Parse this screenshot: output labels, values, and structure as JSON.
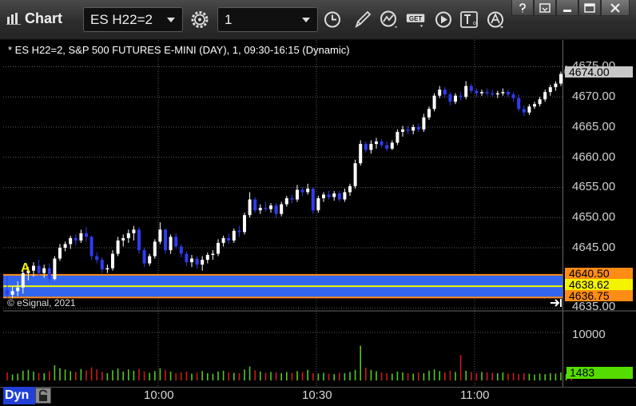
{
  "window": {
    "title": "Chart"
  },
  "toolbar": {
    "symbol": "ES H22=2",
    "interval": "1",
    "buttons": [
      "gear-icon",
      "clock-icon",
      "pencil-icon",
      "study-icon",
      "get-icon",
      "play-icon",
      "text-icon",
      "alert-icon"
    ],
    "get_label": "GET"
  },
  "chart": {
    "header": "* ES H22=2, S&P 500 FUTURES E-MINI (DAY), 1, 09:30-16:15 (Dynamic)",
    "copyright": "© eSignal, 2021",
    "marker_label": "A",
    "dyn_label": "Dyn",
    "colors": {
      "up": "#ffffff",
      "down": "#2f3cf0",
      "grid": "#5a5a5a",
      "band": "#3366ee",
      "vol_up": "#55c81c",
      "vol_down": "#cc1a1a"
    }
  },
  "price_axis": {
    "labels": [
      "4675.00",
      "4670.00",
      "4665.00",
      "4660.00",
      "4655.00",
      "4650.00",
      "4645.00",
      "4635.00"
    ],
    "last_price": "4674.00",
    "upper_level": "4640.50",
    "mid_level": "4638.62",
    "lower_level": "4636.75"
  },
  "volume_axis": {
    "tick": "10000",
    "last_volume": "1483"
  },
  "time_axis": {
    "labels": [
      "10:00",
      "10:30",
      "11:00"
    ]
  },
  "chart_data": {
    "type": "candlestick",
    "ylim": [
      4634.5,
      4676.5
    ],
    "start_time": "09:30",
    "bar_minutes": 1,
    "bars": [
      [
        4638.0,
        4640.2,
        4636.6,
        4637.2
      ],
      [
        4637.2,
        4638.6,
        4636.6,
        4637.8
      ],
      [
        4637.8,
        4639.4,
        4637.0,
        4638.4
      ],
      [
        4638.4,
        4641.2,
        4637.4,
        4640.8
      ],
      [
        4640.8,
        4641.8,
        4639.6,
        4641.2
      ],
      [
        4641.2,
        4642.6,
        4640.2,
        4642.0
      ],
      [
        4642.0,
        4643.0,
        4640.4,
        4640.8
      ],
      [
        4640.8,
        4642.2,
        4640.0,
        4641.6
      ],
      [
        4641.6,
        4642.4,
        4639.2,
        4639.8
      ],
      [
        4639.8,
        4643.6,
        4639.6,
        4643.2
      ],
      [
        4643.2,
        4645.6,
        4642.8,
        4645.0
      ],
      [
        4645.0,
        4646.0,
        4644.4,
        4645.6
      ],
      [
        4645.6,
        4647.0,
        4644.8,
        4646.6
      ],
      [
        4646.6,
        4647.2,
        4645.4,
        4646.2
      ],
      [
        4646.2,
        4648.0,
        4645.8,
        4647.4
      ],
      [
        4647.4,
        4648.4,
        4646.0,
        4646.8
      ],
      [
        4646.8,
        4647.0,
        4643.0,
        4643.6
      ],
      [
        4643.6,
        4644.2,
        4642.4,
        4643.0
      ],
      [
        4643.0,
        4643.4,
        4640.8,
        4641.4
      ],
      [
        4641.4,
        4642.2,
        4640.8,
        4641.6
      ],
      [
        4641.6,
        4644.6,
        4641.2,
        4644.0
      ],
      [
        4644.0,
        4646.8,
        4643.6,
        4646.2
      ],
      [
        4646.2,
        4647.2,
        4645.2,
        4646.6
      ],
      [
        4646.6,
        4648.0,
        4645.8,
        4647.4
      ],
      [
        4647.4,
        4648.6,
        4646.2,
        4648.0
      ],
      [
        4648.0,
        4648.4,
        4644.0,
        4644.6
      ],
      [
        4644.6,
        4645.0,
        4641.8,
        4642.4
      ],
      [
        4642.4,
        4644.0,
        4642.0,
        4643.6
      ],
      [
        4643.6,
        4646.4,
        4643.2,
        4646.0
      ],
      [
        4646.0,
        4649.2,
        4645.6,
        4648.0
      ],
      [
        4648.0,
        4648.2,
        4644.0,
        4644.6
      ],
      [
        4644.6,
        4647.2,
        4644.0,
        4646.8
      ],
      [
        4646.8,
        4647.4,
        4644.8,
        4645.2
      ],
      [
        4645.2,
        4645.6,
        4643.4,
        4644.0
      ],
      [
        4644.0,
        4644.4,
        4642.0,
        4642.6
      ],
      [
        4642.6,
        4643.8,
        4641.8,
        4643.2
      ],
      [
        4643.2,
        4643.6,
        4641.6,
        4642.2
      ],
      [
        4642.2,
        4643.6,
        4641.2,
        4643.0
      ],
      [
        4643.0,
        4644.2,
        4642.4,
        4643.8
      ],
      [
        4643.8,
        4644.6,
        4643.0,
        4644.0
      ],
      [
        4644.0,
        4646.4,
        4643.6,
        4645.8
      ],
      [
        4645.8,
        4647.0,
        4645.2,
        4646.6
      ],
      [
        4646.6,
        4647.4,
        4645.6,
        4646.2
      ],
      [
        4646.2,
        4648.2,
        4645.8,
        4647.8
      ],
      [
        4647.8,
        4648.6,
        4646.8,
        4647.6
      ],
      [
        4647.6,
        4650.8,
        4647.2,
        4650.4
      ],
      [
        4650.4,
        4654.2,
        4650.0,
        4653.0
      ],
      [
        4653.0,
        4653.4,
        4650.8,
        4651.2
      ],
      [
        4651.2,
        4652.2,
        4650.6,
        4651.6
      ],
      [
        4651.6,
        4652.6,
        4651.0,
        4651.4
      ],
      [
        4651.4,
        4652.4,
        4650.8,
        4652.0
      ],
      [
        4652.0,
        4652.4,
        4650.0,
        4650.6
      ],
      [
        4650.6,
        4652.6,
        4650.2,
        4652.2
      ],
      [
        4652.2,
        4653.6,
        4651.8,
        4653.2
      ],
      [
        4653.2,
        4653.8,
        4652.4,
        4653.0
      ],
      [
        4653.0,
        4655.4,
        4652.6,
        4654.6
      ],
      [
        4654.6,
        4655.0,
        4653.6,
        4654.2
      ],
      [
        4654.2,
        4655.6,
        4653.8,
        4654.8
      ],
      [
        4654.8,
        4655.0,
        4650.6,
        4651.2
      ],
      [
        4651.2,
        4653.6,
        4650.8,
        4653.2
      ],
      [
        4653.2,
        4654.2,
        4652.6,
        4653.8
      ],
      [
        4653.8,
        4654.4,
        4653.0,
        4653.4
      ],
      [
        4653.4,
        4654.4,
        4652.8,
        4654.0
      ],
      [
        4654.0,
        4654.4,
        4652.6,
        4653.0
      ],
      [
        4653.0,
        4654.8,
        4652.6,
        4654.2
      ],
      [
        4654.2,
        4655.6,
        4653.6,
        4655.2
      ],
      [
        4655.2,
        4659.6,
        4654.8,
        4659.0
      ],
      [
        4659.0,
        4662.8,
        4658.6,
        4662.2
      ],
      [
        4662.2,
        4662.6,
        4660.8,
        4661.2
      ],
      [
        4661.2,
        4662.8,
        4660.6,
        4662.2
      ],
      [
        4662.2,
        4663.2,
        4661.4,
        4662.6
      ],
      [
        4662.6,
        4663.0,
        4661.6,
        4662.0
      ],
      [
        4662.0,
        4662.6,
        4661.0,
        4661.4
      ],
      [
        4661.4,
        4662.8,
        4661.2,
        4662.4
      ],
      [
        4662.4,
        4664.6,
        4662.0,
        4664.2
      ],
      [
        4664.2,
        4665.2,
        4663.4,
        4664.6
      ],
      [
        4664.6,
        4665.2,
        4663.8,
        4664.4
      ],
      [
        4664.4,
        4665.4,
        4663.8,
        4665.0
      ],
      [
        4665.0,
        4665.6,
        4664.2,
        4664.6
      ],
      [
        4664.6,
        4667.2,
        4664.2,
        4666.6
      ],
      [
        4666.6,
        4668.4,
        4666.2,
        4668.0
      ],
      [
        4668.0,
        4670.6,
        4667.6,
        4670.2
      ],
      [
        4670.2,
        4671.8,
        4669.8,
        4671.2
      ],
      [
        4671.2,
        4671.6,
        4669.8,
        4670.4
      ],
      [
        4670.4,
        4670.8,
        4668.6,
        4669.2
      ],
      [
        4669.2,
        4670.6,
        4668.8,
        4670.2
      ],
      [
        4670.2,
        4670.8,
        4669.4,
        4670.0
      ],
      [
        4670.0,
        4672.6,
        4669.6,
        4671.8
      ],
      [
        4671.8,
        4672.2,
        4670.6,
        4671.0
      ],
      [
        4671.0,
        4671.4,
        4670.0,
        4670.6
      ],
      [
        4670.6,
        4671.2,
        4670.2,
        4670.8
      ],
      [
        4670.8,
        4671.4,
        4670.2,
        4670.6
      ],
      [
        4670.6,
        4671.2,
        4670.0,
        4670.4
      ],
      [
        4670.4,
        4671.0,
        4669.8,
        4670.6
      ],
      [
        4670.6,
        4671.4,
        4670.2,
        4670.8
      ],
      [
        4670.8,
        4671.2,
        4670.0,
        4670.4
      ],
      [
        4670.4,
        4670.8,
        4669.2,
        4669.8
      ],
      [
        4669.8,
        4670.4,
        4667.6,
        4668.0
      ],
      [
        4668.0,
        4668.6,
        4666.8,
        4667.4
      ],
      [
        4667.4,
        4668.8,
        4667.0,
        4668.4
      ],
      [
        4668.4,
        4669.2,
        4668.0,
        4668.8
      ],
      [
        4668.8,
        4670.0,
        4668.4,
        4669.6
      ],
      [
        4669.6,
        4671.2,
        4669.2,
        4670.8
      ],
      [
        4670.8,
        4672.0,
        4670.2,
        4671.6
      ],
      [
        4671.6,
        4672.6,
        4671.0,
        4672.2
      ],
      [
        4672.2,
        4674.2,
        4671.8,
        4673.8
      ],
      [
        4673.8,
        4675.2,
        4673.4,
        4674.6
      ],
      [
        4674.6,
        4675.0,
        4673.6,
        4674.0
      ]
    ],
    "volume": [
      1900,
      1400,
      1600,
      2300,
      2500,
      2100,
      1800,
      1700,
      2200,
      3600,
      2900,
      2600,
      2200,
      2000,
      2700,
      2400,
      3100,
      2600,
      2000,
      1700,
      2400,
      2800,
      2100,
      2600,
      2300,
      2700,
      2100,
      1800,
      2200,
      2900,
      2500,
      2100,
      1700,
      1900,
      2100,
      1600,
      1800,
      2200,
      1700,
      1600,
      2100,
      2300,
      1900,
      1800,
      1700,
      2600,
      3300,
      2400,
      2100,
      1800,
      2000,
      1900,
      1700,
      2000,
      1800,
      2200,
      2000,
      2500,
      1700,
      1600,
      1800,
      1600,
      1500,
      1800,
      1700,
      2000,
      2500,
      8200,
      3000,
      2500,
      2200,
      1900,
      1700,
      1600,
      2100,
      1900,
      1700,
      1600,
      1900,
      1700,
      2300,
      2600,
      2200,
      1900,
      2300,
      2000,
      6000,
      2300,
      2000,
      1700,
      2000,
      1900,
      1800,
      1700,
      1900,
      1600,
      1800,
      1500,
      1700,
      1600,
      1400,
      1600,
      1500,
      1700,
      1600,
      1900,
      1500,
      1483
    ],
    "volume_ylim": [
      0,
      14000
    ],
    "levels": {
      "upper": 4640.5,
      "mid": 4638.62,
      "lower": 4636.75
    }
  }
}
